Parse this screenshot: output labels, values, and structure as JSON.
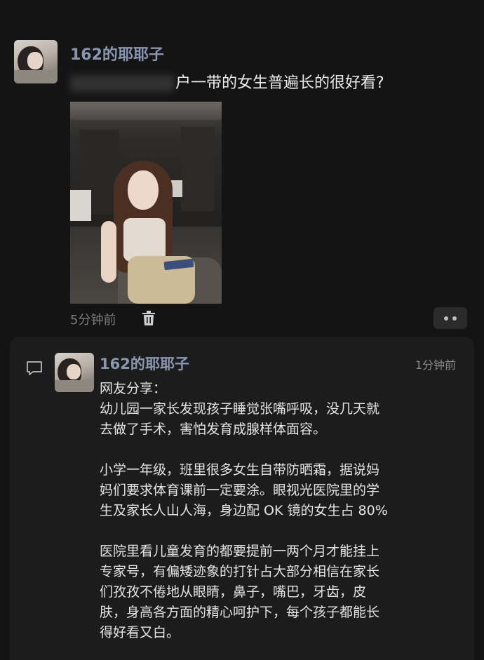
{
  "post": {
    "username": "162的耶耶子",
    "text": "户一带的女生普遍长的很好看?",
    "time_ago": "5分钟前"
  },
  "comment": {
    "username": "162的耶耶子",
    "time_ago": "1分钟前",
    "lines": [
      "网友分享：",
      "幼儿园一家长发现孩子睡觉张嘴呼吸，没几天就",
      "去做了手术，害怕发育成腺样体面容。",
      "",
      "小学一年级，班里很多女生自带防晒霜，据说妈",
      "妈们要求体育课前一定要涂。眼视光医院里的学",
      "生及家长人山人海，身边配 OK 镜的女生占 80%",
      "",
      "医院里看儿童发育的都要提前一两个月才能挂上",
      "专家号，有偏矮迹象的打针占大部分相信在家长",
      "们孜孜不倦地从眼睛，鼻子，嘴巴，牙齿，皮",
      "肤，身高各方面的精心呵护下，每个孩子都能长",
      "得好看又白。"
    ]
  },
  "icons": {
    "trash": "trash-icon",
    "more": "more-dots-icon",
    "comment": "comment-bubble-icon"
  },
  "colors": {
    "background": "#141414",
    "card": "#1c1c1c",
    "username": "#8b96b0"
  }
}
